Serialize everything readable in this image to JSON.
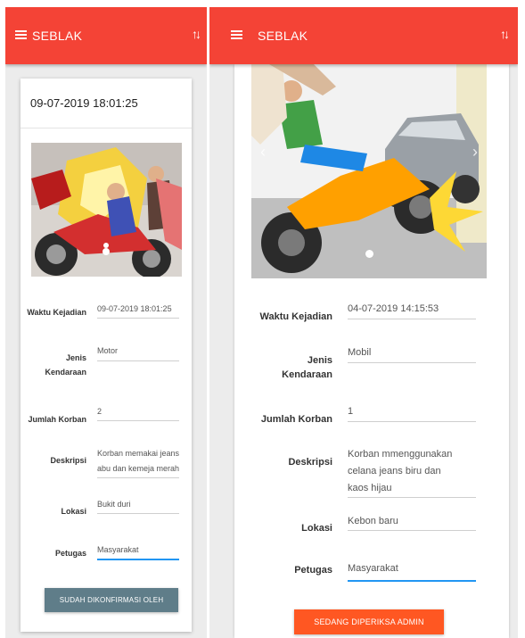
{
  "colors": {
    "appbar": "#f44336",
    "confirmed_button": "#5f7d89",
    "checking_button": "#ff5722",
    "active_underline": "#2196f3"
  },
  "left": {
    "app_title": "SEBLAK",
    "datetime": "09-07-2019 18:01:25",
    "fields": {
      "waktu_label": "Waktu Kejadian",
      "waktu_value": "09-07-2019 18:01:25",
      "jenis_label_1": "Jenis",
      "jenis_label_2": "Kendaraan",
      "jenis_value": "Motor",
      "jumlah_label": "Jumlah Korban",
      "jumlah_value": "2",
      "deskripsi_label": "Deskripsi",
      "deskripsi_value_1": "Korban memakai jeans",
      "deskripsi_value_2": "abu dan kemeja merah",
      "lokasi_label": "Lokasi",
      "lokasi_value": "Bukit duri",
      "petugas_label": "Petugas",
      "petugas_value": "Masyarakat"
    },
    "status_button": "SUDAH DIKONFIRMASI OLEH KELUARGA"
  },
  "right": {
    "app_title": "SEBLAK",
    "fields": {
      "waktu_label": "Waktu Kejadian",
      "waktu_value": "04-07-2019 14:15:53",
      "jenis_label_1": "Jenis",
      "jenis_label_2": "Kendaraan",
      "jenis_value": "Mobil",
      "jumlah_label": "Jumlah Korban",
      "jumlah_value": "1",
      "deskripsi_label": "Deskripsi",
      "deskripsi_value_1": "Korban mmenggunakan",
      "deskripsi_value_2": "celana jeans biru dan",
      "deskripsi_value_3": "kaos hijau",
      "lokasi_label": "Lokasi",
      "lokasi_value": "Kebon baru",
      "petugas_label": "Petugas",
      "petugas_value": "Masyarakat"
    },
    "status_button": "SEDANG DIPERIKSA ADMIN"
  },
  "icons": {
    "menu": "menu-icon",
    "sort": "sort-icon",
    "nav_prev": "chevron-left-icon",
    "nav_next": "chevron-right-icon"
  }
}
